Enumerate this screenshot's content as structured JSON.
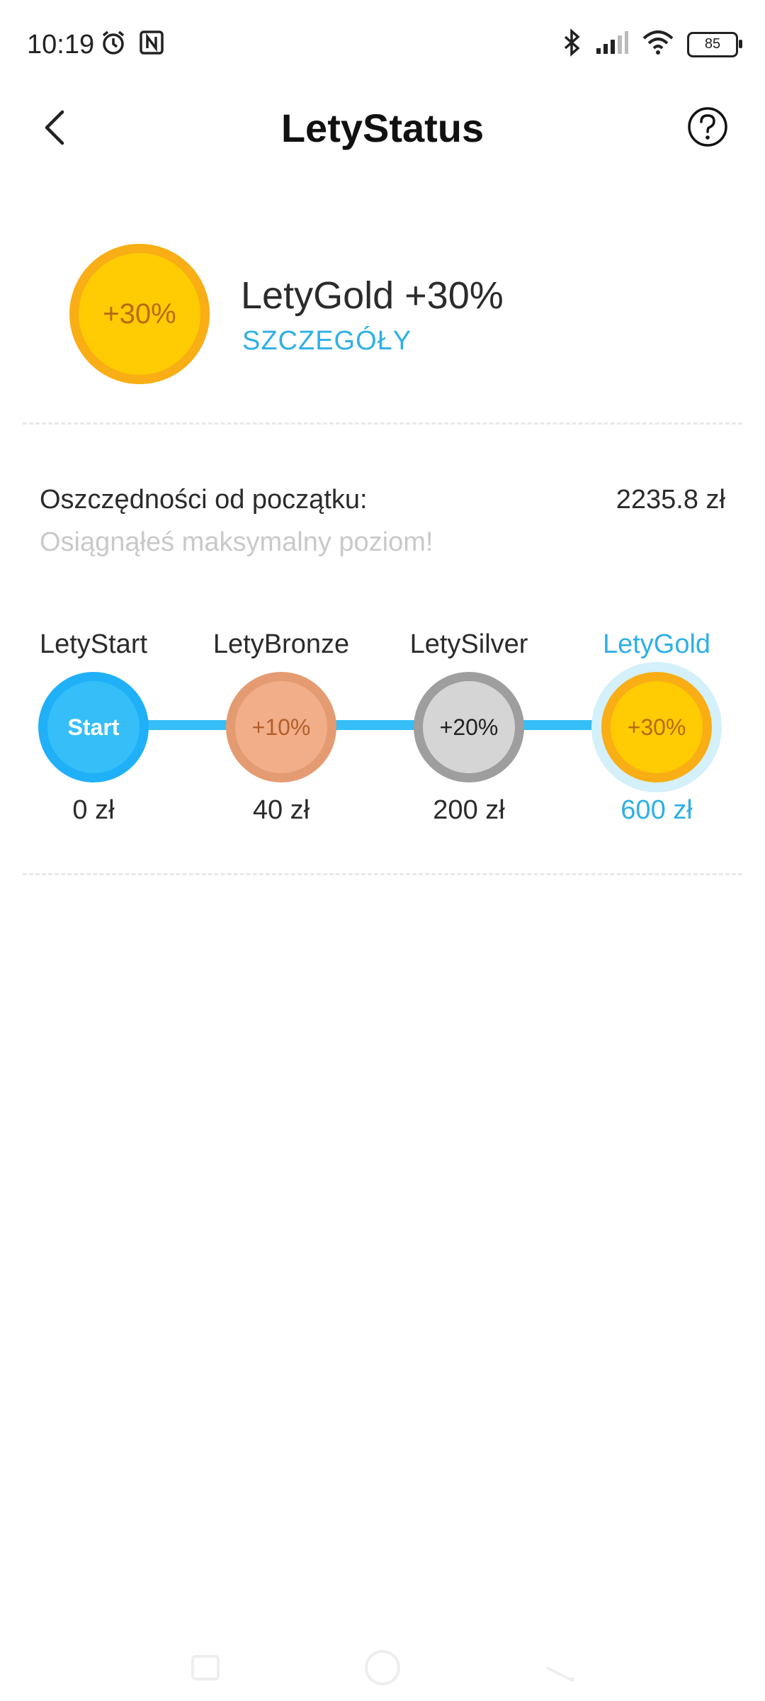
{
  "status_bar": {
    "time": "10:19",
    "battery": "85",
    "icons": [
      "alarm-icon",
      "nfc-icon",
      "bluetooth-icon",
      "signal-icon",
      "wifi-icon",
      "battery-icon"
    ]
  },
  "header": {
    "title": "LetyStatus",
    "back_icon": "back-arrow-icon",
    "help_icon": "help-icon"
  },
  "current_status": {
    "badge": "+30%",
    "title": "LetyGold +30%",
    "details_link": "SZCZEGÓŁY"
  },
  "savings": {
    "label": "Oszczędności od początku:",
    "value": "2235.8 zł",
    "note": "Osiągnąłeś maksymalny poziom!"
  },
  "levels": [
    {
      "name": "LetyStart",
      "badge": "Start",
      "amount": "0 zł",
      "color": "#35bef7"
    },
    {
      "name": "LetyBronze",
      "badge": "+10%",
      "amount": "40 zł",
      "color": "#f1ae89"
    },
    {
      "name": "LetySilver",
      "badge": "+20%",
      "amount": "200 zł",
      "color": "#d5d5d5"
    },
    {
      "name": "LetyGold",
      "badge": "+30%",
      "amount": "600 zł",
      "color": "#ffcb02",
      "current": true
    }
  ],
  "colors": {
    "accent": "#2eb0e6",
    "gold": "#ffcb02",
    "track": "#35bef7"
  },
  "nav_bar": {
    "icons": [
      "recents-icon",
      "home-icon",
      "back-icon"
    ]
  }
}
